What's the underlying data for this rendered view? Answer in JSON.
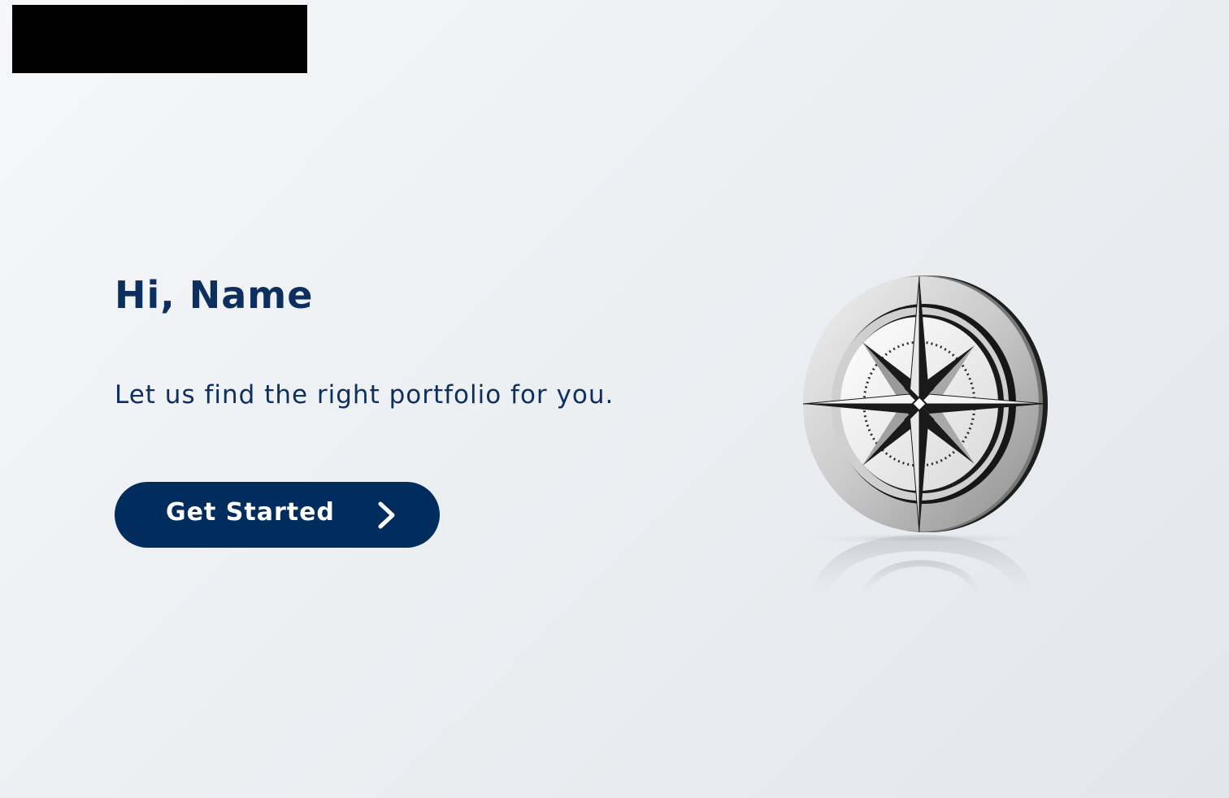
{
  "hero": {
    "greeting": "Hi, Name",
    "tagline": "Let us find the right portfolio for you.",
    "cta_label": "Get Started",
    "cta_icon": "chevron-right-icon"
  },
  "illustration": {
    "icon": "compass-icon"
  },
  "colors": {
    "brand": "#002d5e",
    "text": "#0c2f5e",
    "background": "#eef1f4",
    "redaction": "#000000"
  }
}
